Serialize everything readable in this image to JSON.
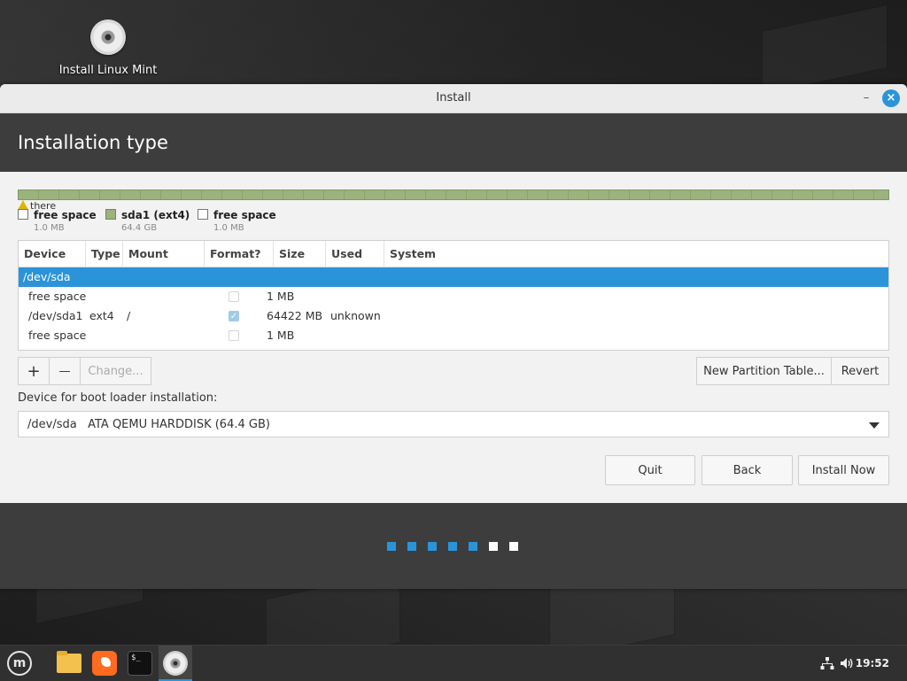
{
  "desktop": {
    "icon_label": "Install Linux Mint"
  },
  "window": {
    "title": "Install",
    "minimize_glyph": "–",
    "close_glyph": "×",
    "heading": "Installation type"
  },
  "partition_bar": {
    "warning_text": "there",
    "legend": [
      {
        "name": "free space",
        "size": "1.0 MB",
        "color": "#ffffff"
      },
      {
        "name": "sda1 (ext4)",
        "size": "64.4 GB",
        "color": "#9cb37e"
      },
      {
        "name": "free space",
        "size": "1.0 MB",
        "color": "#ffffff"
      }
    ]
  },
  "table": {
    "columns": [
      "Device",
      "Type",
      "Mount point",
      "Format?",
      "Size",
      "Used",
      "System"
    ],
    "rows": [
      {
        "device": "/dev/sda",
        "type": "",
        "mount": "",
        "format": null,
        "size": "",
        "used": "",
        "system": "",
        "selected": true
      },
      {
        "device": "free space",
        "type": "",
        "mount": "",
        "format": false,
        "size": "1 MB",
        "used": "",
        "system": ""
      },
      {
        "device": "/dev/sda1",
        "type": "ext4",
        "mount": "/",
        "format": true,
        "size": "64422 MB",
        "used": "unknown",
        "system": ""
      },
      {
        "device": "free space",
        "type": "",
        "mount": "",
        "format": false,
        "size": "1 MB",
        "used": "",
        "system": ""
      }
    ]
  },
  "toolbar": {
    "add_glyph": "+",
    "remove_glyph": "—",
    "change_label": "Change...",
    "new_table_label": "New Partition Table...",
    "revert_label": "Revert"
  },
  "bootloader": {
    "label": "Device for boot loader installation:",
    "device": "/dev/sda",
    "description": "ATA QEMU HARDDISK (64.4 GB)"
  },
  "buttons": {
    "quit": "Quit",
    "back": "Back",
    "install_now": "Install Now"
  },
  "progress": {
    "total_steps": 7,
    "completed_steps": 5,
    "done_color": "#2b94d9",
    "todo_color": "#ffffff"
  },
  "taskbar": {
    "menu_glyph": "m",
    "terminal_glyph": "$_",
    "icons": [
      "mint-menu-icon",
      "files-icon",
      "firefox-icon",
      "terminal-icon",
      "installer-icon",
      "network-icon",
      "volume-icon"
    ],
    "clock": "19:52"
  },
  "colors": {
    "accent": "#2b94d9",
    "header_band": "#3d3d3d",
    "partition_green": "#9cb37e"
  }
}
